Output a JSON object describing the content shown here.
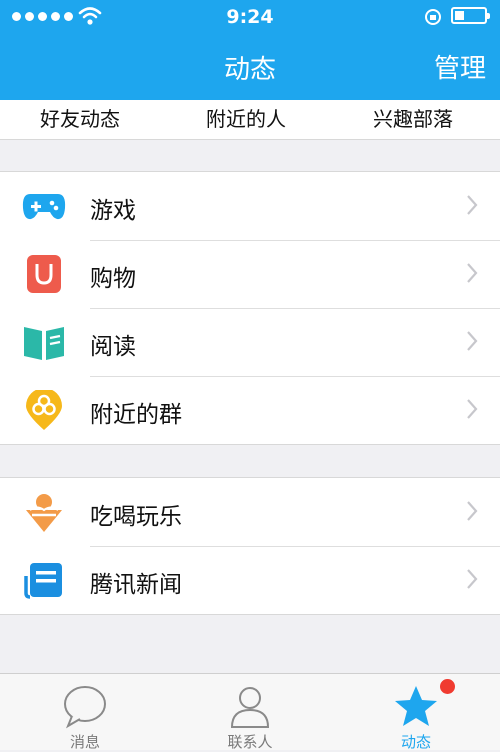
{
  "status_bar": {
    "time": "9:24"
  },
  "header": {
    "title": "动态",
    "manage": "管理"
  },
  "sub_tabs": [
    "好友动态",
    "附近的人",
    "兴趣部落"
  ],
  "group1": [
    {
      "label": "游戏",
      "icon": "gamepad-icon"
    },
    {
      "label": "购物",
      "icon": "shopping-bag-icon"
    },
    {
      "label": "阅读",
      "icon": "book-icon"
    },
    {
      "label": "附近的群",
      "icon": "nearby-group-pin-icon"
    }
  ],
  "group2": [
    {
      "label": "吃喝玩乐",
      "icon": "ice-cream-icon"
    },
    {
      "label": "腾讯新闻",
      "icon": "news-icon"
    }
  ],
  "tabbar": [
    {
      "label": "消息",
      "icon": "chat-bubble-icon",
      "active": false
    },
    {
      "label": "联系人",
      "icon": "contact-person-icon",
      "active": false
    },
    {
      "label": "动态",
      "icon": "star-icon",
      "active": true
    }
  ],
  "colors": {
    "accent": "#1ea6ee",
    "badge": "#f03b30"
  }
}
